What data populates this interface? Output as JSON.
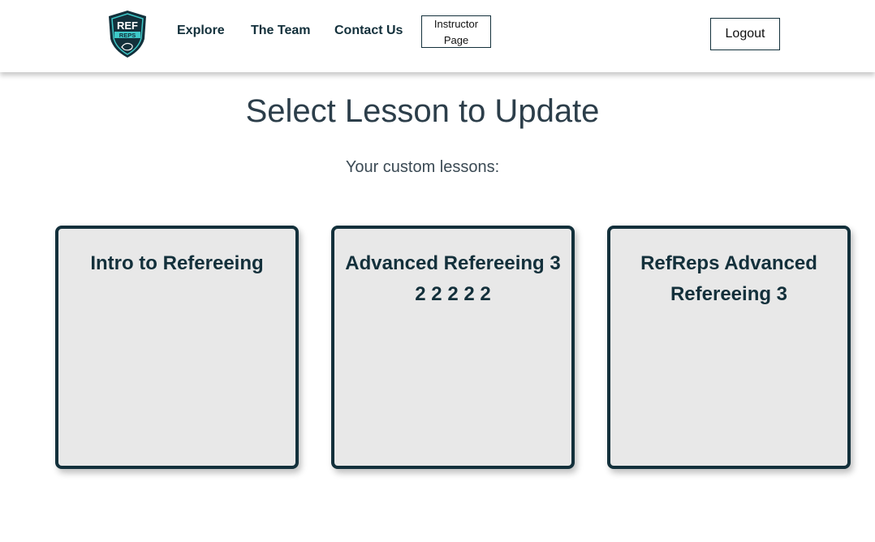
{
  "brand": {
    "logo_text_top": "REF",
    "logo_text_bottom": "REPS",
    "logo_colors": {
      "shield": "#13303b",
      "accent": "#3ec9c9"
    }
  },
  "nav": {
    "explore": "Explore",
    "team": "The Team",
    "contact": "Contact Us",
    "instructor_line1": "Instructor",
    "instructor_line2": "Page",
    "logout": "Logout"
  },
  "main": {
    "title": "Select Lesson to Update",
    "subtitle": "Your custom lessons:"
  },
  "lessons": [
    {
      "title": "Intro to Refereeing"
    },
    {
      "title": "Advanced Refereeing 3 2 2 2 2 2"
    },
    {
      "title": "RefReps Advanced Refereeing 3"
    }
  ],
  "colors": {
    "primary_dark": "#13303b",
    "card_background": "#e8e8e8",
    "title_text": "#2c3e4a"
  }
}
